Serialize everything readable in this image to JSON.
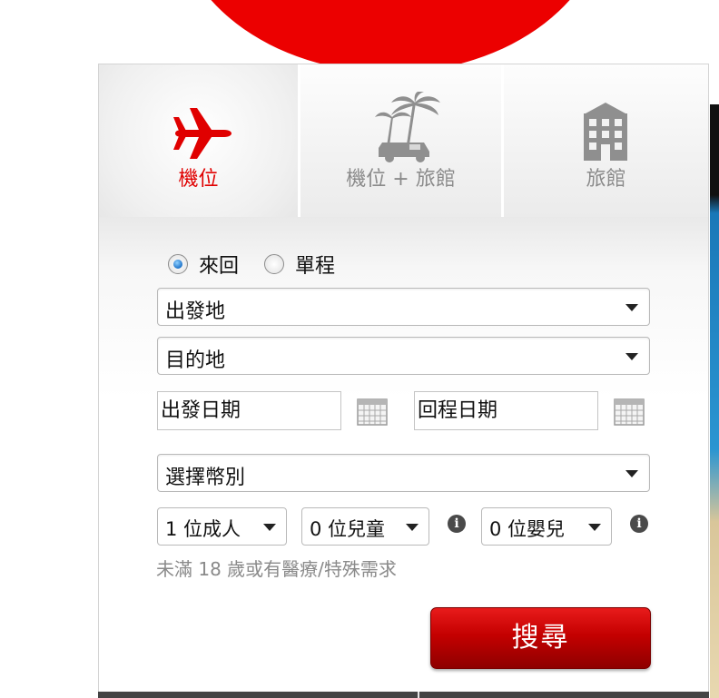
{
  "tabs": [
    {
      "label": "機位",
      "icon": "airplane-icon",
      "active": true
    },
    {
      "label": "機位 + 旅館",
      "icon": "palm-tree-van-icon",
      "active": false
    },
    {
      "label": "旅館",
      "icon": "building-icon",
      "active": false
    }
  ],
  "trip_type": {
    "options": [
      "來回",
      "單程"
    ],
    "selected": "來回"
  },
  "origin": {
    "value": "出發地"
  },
  "destination": {
    "value": "目的地"
  },
  "depart_date": {
    "placeholder": "出發日期"
  },
  "return_date": {
    "placeholder": "回程日期"
  },
  "currency": {
    "value": "選擇幣別"
  },
  "passengers": {
    "adults": "1 位成人",
    "children": "0 位兒童",
    "infants": "0 位嬰兒"
  },
  "note": "未滿 18 歲或有醫療/特殊需求",
  "search_label": "搜尋",
  "colors": {
    "brand_red": "#e00000",
    "tab_inactive_text": "#8a8a8a",
    "radio_selected": "#1e73c9"
  }
}
